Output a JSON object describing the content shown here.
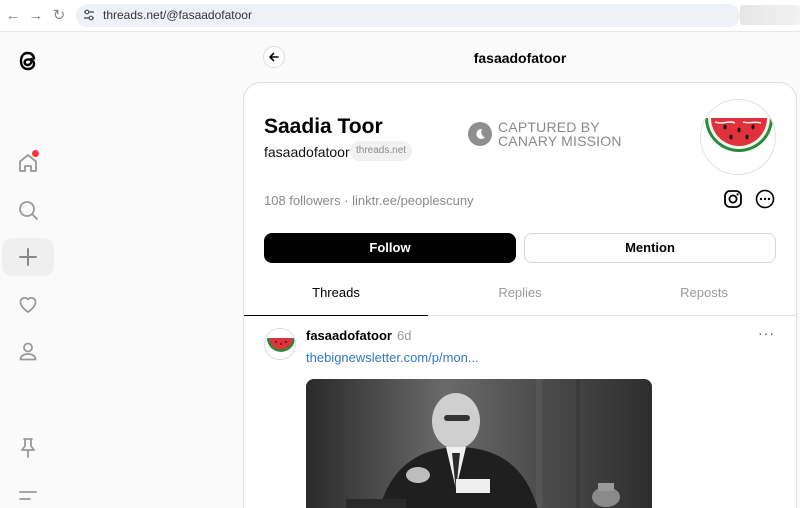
{
  "browser": {
    "url": "threads.net/@fasaadofatoor"
  },
  "header": {
    "title": "fasaadofatoor"
  },
  "profile": {
    "name": "Saadia Toor",
    "handle": "fasaadofatoor",
    "domain_badge": "threads.net",
    "watermark_line1": "CAPTURED BY",
    "watermark_line2": "CANARY MISSION",
    "followers_text": "108 followers · linktr.ee/peoplescuny",
    "follow_label": "Follow",
    "mention_label": "Mention"
  },
  "tabs": [
    {
      "label": "Threads",
      "active": true
    },
    {
      "label": "Replies",
      "active": false
    },
    {
      "label": "Reposts",
      "active": false
    }
  ],
  "post": {
    "user": "fasaadofatoor",
    "time": "6d",
    "link": "thebignewsletter.com/p/mon...",
    "more": "···"
  },
  "icons": {
    "threads_logo": "threads-logo-icon",
    "home": "home-icon",
    "search": "search-icon",
    "create": "plus-icon",
    "activity": "heart-icon",
    "profile": "person-icon",
    "pin": "pin-icon",
    "menu": "menu-icon"
  },
  "colors": {
    "link": "#2f78c4",
    "notification": "#ff3040",
    "watermelon_red": "#e0323c",
    "watermelon_green": "#2a8a3c"
  }
}
